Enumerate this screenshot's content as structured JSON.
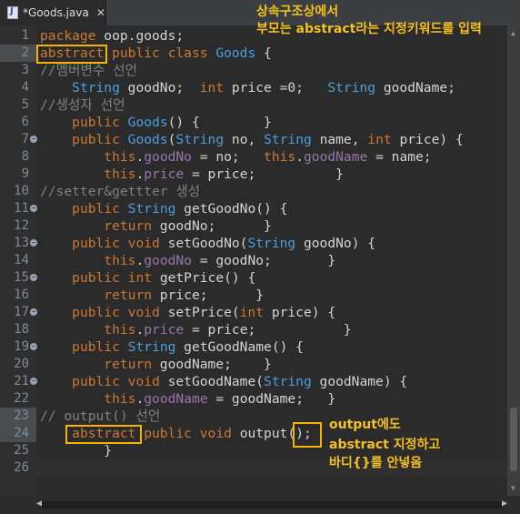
{
  "tab": {
    "title": "*Goods.java",
    "close": "✕"
  },
  "annotations": {
    "top_line1": "상속구조상에서",
    "top_line2": "부모는 abstract라는 지정키워드를 입력",
    "side_line1": "output에도",
    "side_line2": "abstract 지정하고",
    "side_line3": "바디{}를 안넣음"
  },
  "lines": [
    {
      "n": "1",
      "tokens": [
        [
          "kw",
          "package "
        ],
        [
          "plain",
          "oop.goods;"
        ]
      ]
    },
    {
      "n": "2",
      "tokens": [
        [
          "kw",
          "abstract"
        ],
        [
          "kw",
          " public class "
        ],
        [
          "type",
          "Goods"
        ],
        [
          "plain",
          " {"
        ]
      ]
    },
    {
      "n": "3",
      "tokens": [
        [
          "cmt",
          "//멤버변수 선언"
        ]
      ]
    },
    {
      "n": "4",
      "tokens": [
        [
          "plain",
          "    "
        ],
        [
          "type",
          "String"
        ],
        [
          "plain",
          " goodNo;  "
        ],
        [
          "kw",
          "int"
        ],
        [
          "plain",
          " price =0;   "
        ],
        [
          "type",
          "String"
        ],
        [
          "plain",
          " goodName;"
        ]
      ]
    },
    {
      "n": "5",
      "tokens": [
        [
          "cmt",
          "//생성자 선언"
        ]
      ]
    },
    {
      "n": "6",
      "tokens": [
        [
          "plain",
          "    "
        ],
        [
          "kw",
          "public "
        ],
        [
          "type",
          "Goods"
        ],
        [
          "plain",
          "() {        }"
        ]
      ]
    },
    {
      "n": "7",
      "tokens": [
        [
          "plain",
          "    "
        ],
        [
          "kw",
          "public "
        ],
        [
          "type",
          "Goods"
        ],
        [
          "plain",
          "("
        ],
        [
          "type",
          "String"
        ],
        [
          "plain",
          " no, "
        ],
        [
          "type",
          "String"
        ],
        [
          "plain",
          " name, "
        ],
        [
          "kw",
          "int"
        ],
        [
          "plain",
          " price) {"
        ]
      ]
    },
    {
      "n": "8",
      "tokens": [
        [
          "plain",
          "        "
        ],
        [
          "kw",
          "this"
        ],
        [
          "plain",
          "."
        ],
        [
          "fld",
          "goodNo"
        ],
        [
          "plain",
          " = no;   "
        ],
        [
          "kw",
          "this"
        ],
        [
          "plain",
          "."
        ],
        [
          "fld",
          "goodName"
        ],
        [
          "plain",
          " = name;"
        ]
      ]
    },
    {
      "n": "9",
      "tokens": [
        [
          "plain",
          "        "
        ],
        [
          "kw",
          "this"
        ],
        [
          "plain",
          "."
        ],
        [
          "fld",
          "price"
        ],
        [
          "plain",
          " = price;          }"
        ]
      ]
    },
    {
      "n": "10",
      "tokens": [
        [
          "cmt",
          "//setter&gettter 생성"
        ]
      ]
    },
    {
      "n": "11",
      "tokens": [
        [
          "plain",
          "    "
        ],
        [
          "kw",
          "public "
        ],
        [
          "type",
          "String"
        ],
        [
          "plain",
          " getGoodNo() {"
        ]
      ]
    },
    {
      "n": "12",
      "tokens": [
        [
          "plain",
          "        "
        ],
        [
          "kw",
          "return"
        ],
        [
          "plain",
          " goodNo;      }"
        ]
      ]
    },
    {
      "n": "13",
      "tokens": [
        [
          "plain",
          "    "
        ],
        [
          "kw",
          "public void "
        ],
        [
          "plain",
          "setGoodNo("
        ],
        [
          "type",
          "String"
        ],
        [
          "plain",
          " goodNo) {"
        ]
      ]
    },
    {
      "n": "14",
      "tokens": [
        [
          "plain",
          "        "
        ],
        [
          "kw",
          "this"
        ],
        [
          "plain",
          "."
        ],
        [
          "fld",
          "goodNo"
        ],
        [
          "plain",
          " = goodNo;       }"
        ]
      ]
    },
    {
      "n": "15",
      "tokens": [
        [
          "plain",
          "    "
        ],
        [
          "kw",
          "public int "
        ],
        [
          "plain",
          "getPrice() {"
        ]
      ]
    },
    {
      "n": "16",
      "tokens": [
        [
          "plain",
          "        "
        ],
        [
          "kw",
          "return"
        ],
        [
          "plain",
          " price;      }"
        ]
      ]
    },
    {
      "n": "17",
      "tokens": [
        [
          "plain",
          "    "
        ],
        [
          "kw",
          "public void "
        ],
        [
          "plain",
          "setPrice("
        ],
        [
          "kw",
          "int"
        ],
        [
          "plain",
          " price) {"
        ]
      ]
    },
    {
      "n": "18",
      "tokens": [
        [
          "plain",
          "        "
        ],
        [
          "kw",
          "this"
        ],
        [
          "plain",
          "."
        ],
        [
          "fld",
          "price"
        ],
        [
          "plain",
          " = price;           }"
        ]
      ]
    },
    {
      "n": "19",
      "tokens": [
        [
          "plain",
          "    "
        ],
        [
          "kw",
          "public "
        ],
        [
          "type",
          "String"
        ],
        [
          "plain",
          " getGoodName() {"
        ]
      ]
    },
    {
      "n": "20",
      "tokens": [
        [
          "plain",
          "        "
        ],
        [
          "kw",
          "return"
        ],
        [
          "plain",
          " goodName;    }"
        ]
      ]
    },
    {
      "n": "21",
      "tokens": [
        [
          "plain",
          "    "
        ],
        [
          "kw",
          "public void "
        ],
        [
          "plain",
          "setGoodName("
        ],
        [
          "type",
          "String"
        ],
        [
          "plain",
          " goodName) {"
        ]
      ]
    },
    {
      "n": "22",
      "tokens": [
        [
          "plain",
          "        "
        ],
        [
          "kw",
          "this"
        ],
        [
          "plain",
          "."
        ],
        [
          "fld",
          "goodName"
        ],
        [
          "plain",
          " = goodName;   }"
        ]
      ]
    },
    {
      "n": "23",
      "tokens": [
        [
          "cmt",
          "// output() 선언"
        ]
      ]
    },
    {
      "n": "24",
      "tokens": [
        [
          "plain",
          "    "
        ],
        [
          "kw",
          "abstract"
        ],
        [
          "kw",
          " public void "
        ],
        [
          "plain",
          "output();"
        ]
      ]
    },
    {
      "n": "25",
      "tokens": [
        [
          "plain",
          "        }"
        ]
      ]
    },
    {
      "n": "26",
      "tokens": []
    }
  ],
  "fold_markers": [
    "7",
    "11",
    "13",
    "15",
    "17",
    "19",
    "21"
  ]
}
